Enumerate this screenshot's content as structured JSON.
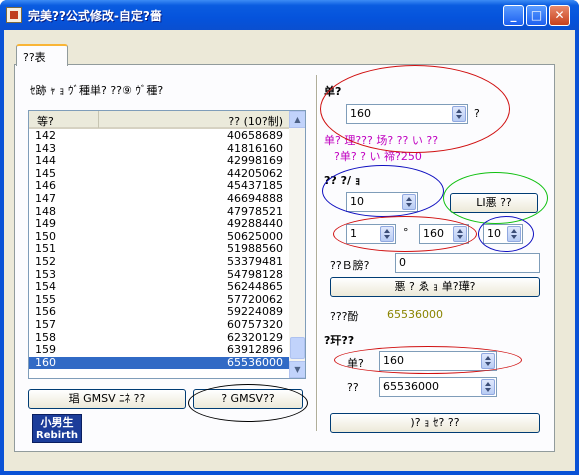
{
  "window": {
    "title": "完美??公式修改-自定?嗇"
  },
  "tab": {
    "label": "??表"
  },
  "left": {
    "caption": "ｾ跡   ｬ         ｮ ｳﾞ種単?  ??⑨ ｳﾞ種?",
    "columns": [
      "等?",
      "?? (10?制)"
    ],
    "rows": [
      [
        "142",
        "40658689"
      ],
      [
        "143",
        "41816160"
      ],
      [
        "144",
        "42998169"
      ],
      [
        "145",
        "44205062"
      ],
      [
        "146",
        "45437185"
      ],
      [
        "147",
        "46694888"
      ],
      [
        "148",
        "47978521"
      ],
      [
        "149",
        "49288440"
      ],
      [
        "150",
        "50625000"
      ],
      [
        "151",
        "51988560"
      ],
      [
        "152",
        "53379481"
      ],
      [
        "153",
        "54798128"
      ],
      [
        "154",
        "56244865"
      ],
      [
        "155",
        "57720062"
      ],
      [
        "156",
        "59224089"
      ],
      [
        "157",
        "60757320"
      ],
      [
        "158",
        "62320129"
      ],
      [
        "159",
        "63912896"
      ],
      [
        "160",
        "65536000"
      ]
    ],
    "selected_row": "160",
    "btn_left": "琩  GMSV  ﾆﾈ  ??",
    "btn_right": "?    GMSV??",
    "logo_line1": "小男生",
    "logo_line2": "Rebirth"
  },
  "right": {
    "label_single": "单?",
    "single_value": "160",
    "single_suffix": "?",
    "hint1": "单?   理???  场?  ??   い   ??",
    "hint2": "?单?    ?   い 禘?250",
    "label_formula": "??  ?/   ｮ",
    "formula_value": "10",
    "formula_button": "LI悪   ??",
    "min_value": "1",
    "max_value": "160",
    "step_value": "10",
    "exp_label": "??Ｂ膀?",
    "exp_value": "0",
    "calc_button": "悪        ?   ゑ   ｮ      单?璍?",
    "max_exp_label": "???酚",
    "max_exp_value": "65536000",
    "label_query": "?玕??",
    "query_level_label": "单?",
    "query_level_value": "160",
    "query_exp_label": "??",
    "query_exp_value": "65536000",
    "bottom_button": ")?   ｮ ｾ?  ??"
  },
  "colors": {
    "accent": "#316ac5",
    "highlight": "#c000c0",
    "olive": "#8a8400",
    "red_mark": "#d01010",
    "blue_mark": "#1010c0",
    "green_mark": "#10c010"
  }
}
